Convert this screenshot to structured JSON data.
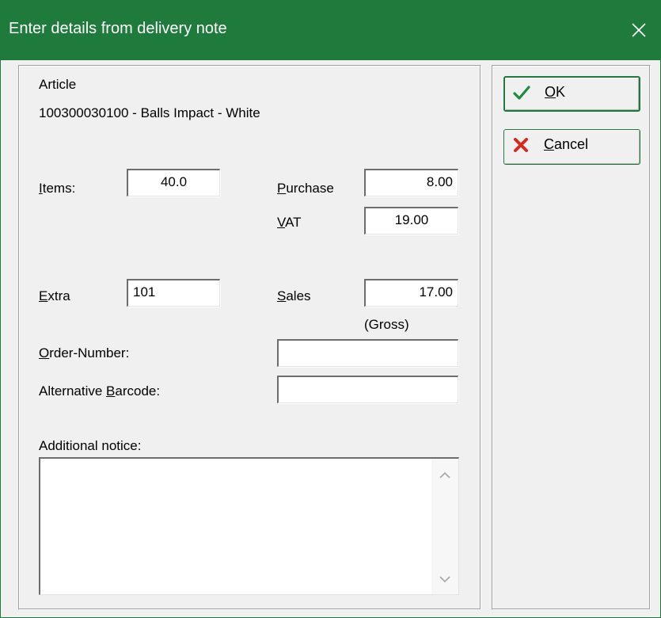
{
  "window": {
    "title": "Enter details from delivery note",
    "close_icon": "close-icon"
  },
  "article": {
    "label": "Article",
    "value": "100300030100 - Balls Impact - White"
  },
  "fields": {
    "items": {
      "label_underline": "I",
      "label_rest": "tems:",
      "value": "40.0"
    },
    "purchase": {
      "label_underline": "P",
      "label_rest": "urchase",
      "value": "8.00"
    },
    "vat": {
      "label_underline": "V",
      "label_rest": "AT",
      "value": "19.00"
    },
    "extra": {
      "label_underline": "E",
      "label_rest": "xtra",
      "value": "101"
    },
    "sales": {
      "label_underline": "S",
      "label_rest": "ales",
      "value": "17.00"
    },
    "gross_note": "(Gross)",
    "order_number": {
      "label_underline": "O",
      "label_rest": "rder-Number:",
      "value": ""
    },
    "alt_barcode": {
      "label_prefix": "Alternative ",
      "label_underline": "B",
      "label_rest": "arcode:",
      "value": ""
    },
    "notice": {
      "label": "Additional notice:",
      "value": ""
    }
  },
  "buttons": {
    "ok": {
      "underline": "O",
      "rest": "K",
      "icon": "checkmark-icon",
      "color": "#1e7b3c"
    },
    "cancel": {
      "underline": "C",
      "rest": "ancel",
      "icon": "red-x-icon",
      "color": "#d42a1e"
    }
  },
  "colors": {
    "titlebar": "#1e7b3c",
    "accent": "#1e7b3c"
  }
}
